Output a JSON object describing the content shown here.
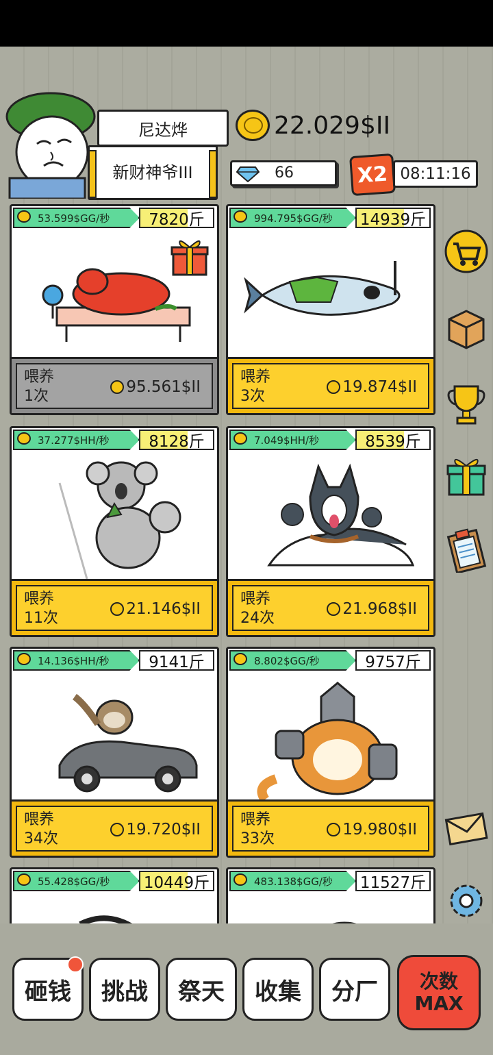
{
  "player": {
    "name": "尼达烨",
    "title": "新财神爷III",
    "coins": "22.029$II",
    "gems": "66",
    "boost": "X2",
    "timer": "08:11:16"
  },
  "cards": [
    {
      "rate": "53.599$GG/秒",
      "weight": "7820斤",
      "feed_label": "喂养",
      "feed_count": "1次",
      "price": "95.561$II",
      "animal": "lobster"
    },
    {
      "rate": "994.795$GG/秒",
      "weight": "14939斤",
      "feed_label": "喂养",
      "feed_count": "3次",
      "price": "19.874$II",
      "animal": "fish"
    },
    {
      "rate": "37.277$HH/秒",
      "weight": "8128斤",
      "feed_label": "喂养",
      "feed_count": "11次",
      "price": "21.146$II",
      "animal": "koala"
    },
    {
      "rate": "7.049$HH/秒",
      "weight": "8539斤",
      "feed_label": "喂养",
      "feed_count": "24次",
      "price": "21.968$II",
      "animal": "husky"
    },
    {
      "rate": "14.136$HH/秒",
      "weight": "9141斤",
      "feed_label": "喂养",
      "feed_count": "34次",
      "price": "19.720$II",
      "animal": "sloth"
    },
    {
      "rate": "8.802$GG/秒",
      "weight": "9757斤",
      "feed_label": "喂养",
      "feed_count": "33次",
      "price": "19.980$II",
      "animal": "robot-cat"
    },
    {
      "rate": "55.428$GG/秒",
      "weight": "10449斤",
      "animal": "partial"
    },
    {
      "rate": "483.138$GG/秒",
      "weight": "11527斤",
      "animal": "partial"
    }
  ],
  "side_icons": [
    "shop-cart-icon",
    "box-icon",
    "trophy-icon",
    "gift-icon",
    "clipboard-icon",
    "mail-icon",
    "settings-gear-icon"
  ],
  "nav": {
    "smash": "砸钱",
    "challenge": "挑战",
    "worship": "祭天",
    "collect": "收集",
    "branch": "分厂",
    "max_line1": "次数",
    "max_line2": "MAX"
  }
}
